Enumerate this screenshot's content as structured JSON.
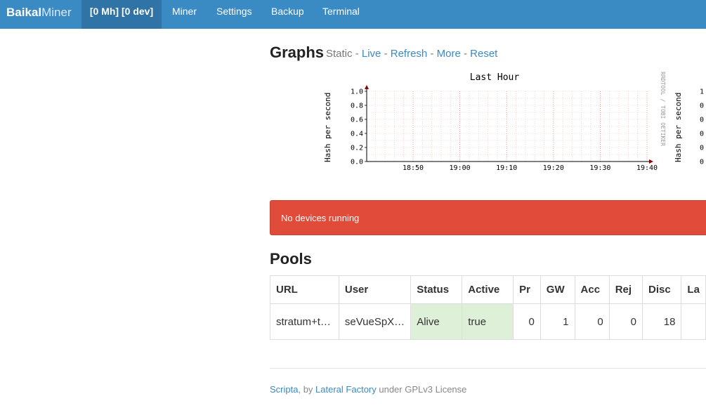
{
  "navbar": {
    "brand_bold": "Baikal",
    "brand_light": "Miner",
    "status": "[0 Mh] [0 dev]",
    "items": [
      "Miner",
      "Settings",
      "Backup",
      "Terminal"
    ]
  },
  "graphs": {
    "title": "Graphs",
    "static_label": "Static",
    "links": [
      "Live",
      "Refresh",
      "More",
      "Reset"
    ]
  },
  "chart_data": {
    "type": "line",
    "title": "Last Hour",
    "ylabel": "Hash per second",
    "watermark": "RRDTOOL / TOBI OETIKER",
    "ylim": [
      0,
      1.0
    ],
    "yticks": [
      "1.0",
      "0.8",
      "0.6",
      "0.4",
      "0.2",
      "0.0"
    ],
    "xticks": [
      "18:50",
      "19:00",
      "19:10",
      "19:20",
      "19:30",
      "19:40"
    ],
    "series": [],
    "grid": true,
    "second_chart_ylabel": "Hash per second"
  },
  "alert": {
    "message": "No devices running"
  },
  "pools": {
    "title": "Pools",
    "columns": [
      "URL",
      "User",
      "Status",
      "Active",
      "Pr",
      "GW",
      "Acc",
      "Rej",
      "Disc",
      "La"
    ],
    "rows": [
      [
        "stratum+t…",
        "seVueSpX…",
        "Alive",
        "true",
        "0",
        "1",
        "0",
        "0",
        "18",
        ""
      ]
    ]
  },
  "footer": {
    "link1": "Scripta",
    "text1": ", by ",
    "link2": "Lateral Factory",
    "text2": " under GPLv3 License"
  },
  "colors": {
    "navbar": "#3a8ac4",
    "navbar_active": "#2f73a7",
    "alert": "#e04b3a",
    "success_cell": "#dff0d8",
    "link": "#3a8ac4"
  }
}
